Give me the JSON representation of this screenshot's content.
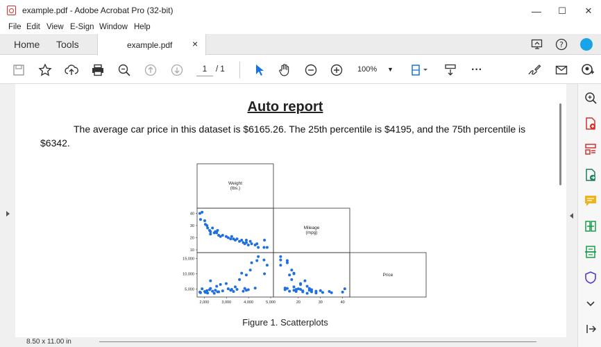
{
  "window": {
    "title": "example.pdf - Adobe Acrobat Pro (32-bit)",
    "minimize": "—",
    "maximize": "☐",
    "close": "✕"
  },
  "menu": [
    "File",
    "Edit",
    "View",
    "E-Sign",
    "Window",
    "Help"
  ],
  "tabs": {
    "home": "Home",
    "tools": "Tools",
    "document": "example.pdf",
    "close": "×"
  },
  "toolbar": {
    "page_current": "1",
    "page_total": "/ 1",
    "zoom": "100%",
    "more": "···"
  },
  "status": {
    "page_size": "8.50 x 11.00 in"
  },
  "document": {
    "title": "Auto report",
    "paragraph": "The average car price in this dataset is $6165.26. The 25th percentile is $4195, and the 75th percentile is $6342.",
    "caption": "Figure 1. Scatterplots"
  },
  "chart_data": {
    "type": "scatter",
    "subtype": "scatterplot-matrix-lower-half",
    "variables": [
      {
        "name": "Weight",
        "unit": "(lbs.)"
      },
      {
        "name": "Mileage",
        "unit": "(mpg)"
      },
      {
        "name": "Price",
        "unit": ""
      }
    ],
    "axes": {
      "weight": {
        "ticks": [
          "2,000",
          "3,000",
          "4,000",
          "5,000"
        ],
        "range": [
          1800,
          5000
        ]
      },
      "mileage": {
        "ticks": [
          "10",
          "20",
          "30",
          "40"
        ],
        "ticks_x": [
          "20",
          "30",
          "40"
        ],
        "range": [
          10,
          42
        ]
      },
      "price": {
        "ticks": [
          "5,000",
          "10,000",
          "15,000"
        ],
        "range": [
          3300,
          16000
        ]
      }
    },
    "cars": [
      [
        1830,
        35,
        3800
      ],
      [
        1800,
        40,
        4000
      ],
      [
        2020,
        34,
        4200
      ],
      [
        2050,
        31,
        3900
      ],
      [
        2120,
        30,
        4500
      ],
      [
        2150,
        28,
        3700
      ],
      [
        2240,
        26,
        4800
      ],
      [
        2280,
        25,
        5200
      ],
      [
        2370,
        28,
        4300
      ],
      [
        2450,
        24,
        3600
      ],
      [
        2500,
        25,
        4600
      ],
      [
        2560,
        24,
        5900
      ],
      [
        2650,
        22,
        4100
      ],
      [
        2730,
        21,
        6500
      ],
      [
        2830,
        22,
        4400
      ],
      [
        2990,
        21,
        6800
      ],
      [
        3080,
        20,
        5100
      ],
      [
        3190,
        19,
        4600
      ],
      [
        3240,
        21,
        4900
      ],
      [
        3320,
        19,
        4200
      ],
      [
        3400,
        18,
        5700
      ],
      [
        3480,
        19,
        4900
      ],
      [
        3590,
        17,
        8100
      ],
      [
        3690,
        18,
        10200
      ],
      [
        3760,
        16,
        4300
      ],
      [
        3830,
        15,
        5200
      ],
      [
        3900,
        16,
        9600
      ],
      [
        3990,
        14,
        4800
      ],
      [
        4080,
        17,
        11200
      ],
      [
        4140,
        15,
        13600
      ],
      [
        4300,
        14,
        5300
      ],
      [
        4380,
        15,
        14300
      ],
      [
        4440,
        12,
        15600
      ],
      [
        4700,
        12,
        14500
      ],
      [
        4840,
        12,
        12800
      ],
      [
        4720,
        18,
        10000
      ],
      [
        1900,
        41,
        5100
      ],
      [
        2280,
        23,
        7700
      ],
      [
        3900,
        18,
        4600
      ],
      [
        2600,
        26,
        4100
      ]
    ]
  }
}
